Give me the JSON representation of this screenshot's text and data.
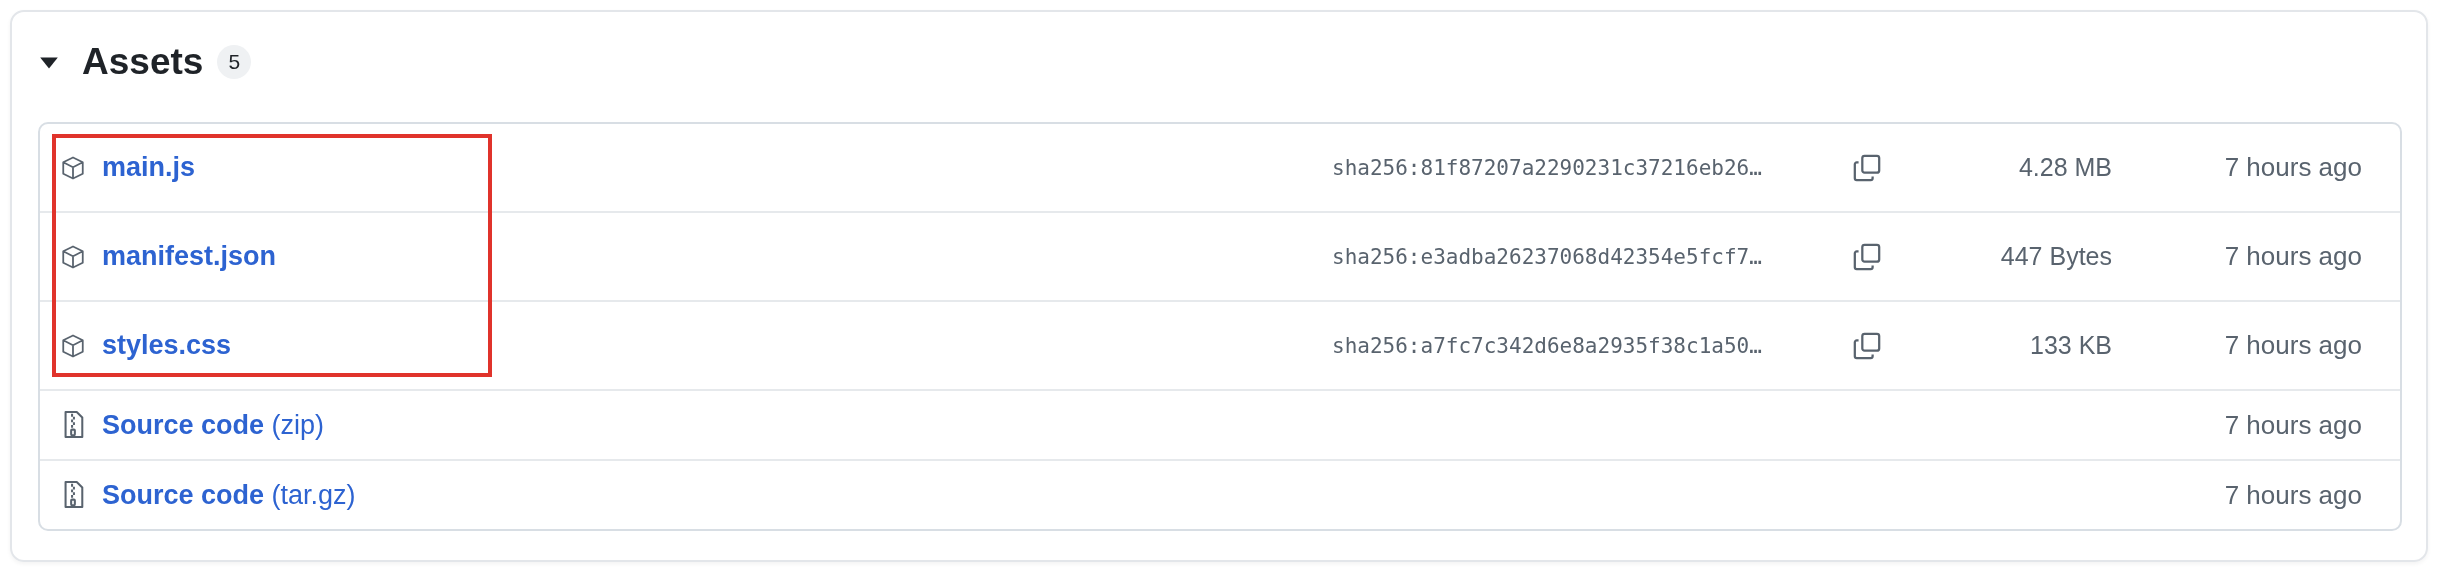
{
  "section": {
    "title": "Assets",
    "count": "5",
    "expanded": true
  },
  "assets": [
    {
      "kind": "package",
      "name": "main.js",
      "hash": "sha256:81f87207a2290231c37216eb26…",
      "size": "4.28 MB",
      "date": "7 hours ago"
    },
    {
      "kind": "package",
      "name": "manifest.json",
      "hash": "sha256:e3adba26237068d42354e5fcf7…",
      "size": "447 Bytes",
      "date": "7 hours ago"
    },
    {
      "kind": "package",
      "name": "styles.css",
      "hash": "sha256:a7fc7c342d6e8a2935f38c1a50…",
      "size": "133 KB",
      "date": "7 hours ago"
    },
    {
      "kind": "source",
      "name": "**Source code** (zip)",
      "date": "7 hours ago"
    },
    {
      "kind": "source",
      "name": "**Source code** (tar.gz)",
      "date": "7 hours ago"
    }
  ]
}
